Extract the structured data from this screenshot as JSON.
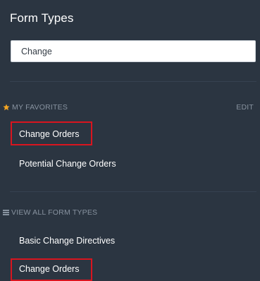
{
  "title": "Form Types",
  "search": {
    "value": "Change",
    "placeholder": ""
  },
  "favorites": {
    "header": "MY FAVORITES",
    "edit_label": "EDIT",
    "items": [
      {
        "label": "Change Orders",
        "highlighted": true
      },
      {
        "label": "Potential Change Orders",
        "highlighted": false
      }
    ]
  },
  "all_types": {
    "header": "VIEW ALL FORM TYPES",
    "items": [
      {
        "label": "Basic Change Directives",
        "highlighted": false
      },
      {
        "label": "Change Orders",
        "highlighted": true
      }
    ]
  },
  "colors": {
    "background": "#2b3541",
    "star": "#f5a623",
    "highlight_border": "#d9151f",
    "muted_text": "#8893a0"
  },
  "icons": {
    "favorites": "star-icon",
    "all_types": "menu-icon"
  }
}
